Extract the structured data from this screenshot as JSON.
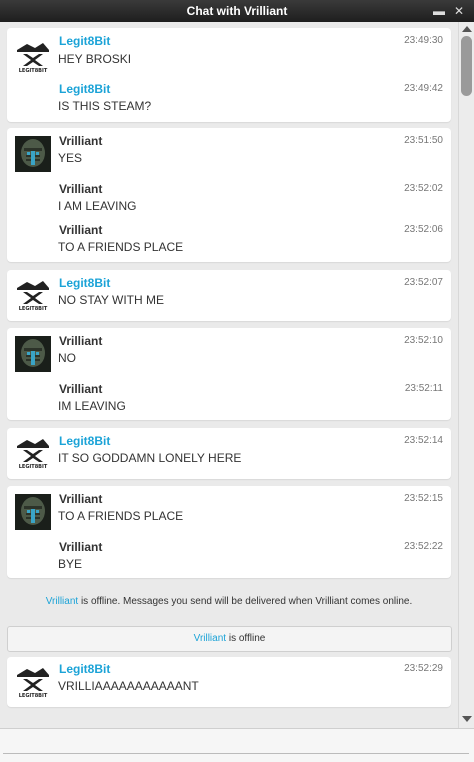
{
  "window": {
    "title": "Chat with Vrilliant",
    "minimize_glyph": "▬",
    "close_glyph": "✕"
  },
  "users": {
    "legit": {
      "name": "Legit8Bit",
      "color": "#1ba3d7",
      "avatar_icon": "legit8bit-logo-icon",
      "avatar_text": "LEGIT8BIT"
    },
    "vrill": {
      "name": "Vrilliant",
      "color": "#333333",
      "avatar_icon": "dead-space-helmet-icon"
    }
  },
  "groups": [
    {
      "sender": "Legit8Bit",
      "messages": [
        {
          "name": "Legit8Bit",
          "time": "23:49:30",
          "text": "HEY BROSKI"
        },
        {
          "name": "Legit8Bit",
          "time": "23:49:42",
          "text": "IS THIS STEAM?"
        }
      ]
    },
    {
      "sender": "Vrilliant",
      "messages": [
        {
          "name": "Vrilliant",
          "time": "23:51:50",
          "text": "YES"
        },
        {
          "name": "Vrilliant",
          "time": "23:52:02",
          "text": "I AM LEAVING"
        },
        {
          "name": "Vrilliant",
          "time": "23:52:06",
          "text": "TO A FRIENDS PLACE"
        }
      ]
    },
    {
      "sender": "Legit8Bit",
      "messages": [
        {
          "name": "Legit8Bit",
          "time": "23:52:07",
          "text": "NO STAY WITH ME"
        }
      ]
    },
    {
      "sender": "Vrilliant",
      "messages": [
        {
          "name": "Vrilliant",
          "time": "23:52:10",
          "text": "NO"
        },
        {
          "name": "Vrilliant",
          "time": "23:52:11",
          "text": "IM LEAVING"
        }
      ]
    },
    {
      "sender": "Legit8Bit",
      "messages": [
        {
          "name": "Legit8Bit",
          "time": "23:52:14",
          "text": "IT SO GODDAMN LONELY HERE"
        }
      ]
    },
    {
      "sender": "Vrilliant",
      "messages": [
        {
          "name": "Vrilliant",
          "time": "23:52:15",
          "text": "TO A FRIENDS PLACE"
        },
        {
          "name": "Vrilliant",
          "time": "23:52:22",
          "text": "BYE"
        }
      ]
    },
    {
      "sender": "Legit8Bit",
      "messages": [
        {
          "name": "Legit8Bit",
          "time": "23:52:29",
          "text": "VRILLIAAAAAAAAAAANT"
        }
      ]
    }
  ],
  "offline_notice": {
    "name": "Vrilliant",
    "text": " is offline. Messages you send will be delivered when Vrilliant comes online."
  },
  "status_bar": {
    "name": "Vrilliant",
    "text": " is offline"
  }
}
